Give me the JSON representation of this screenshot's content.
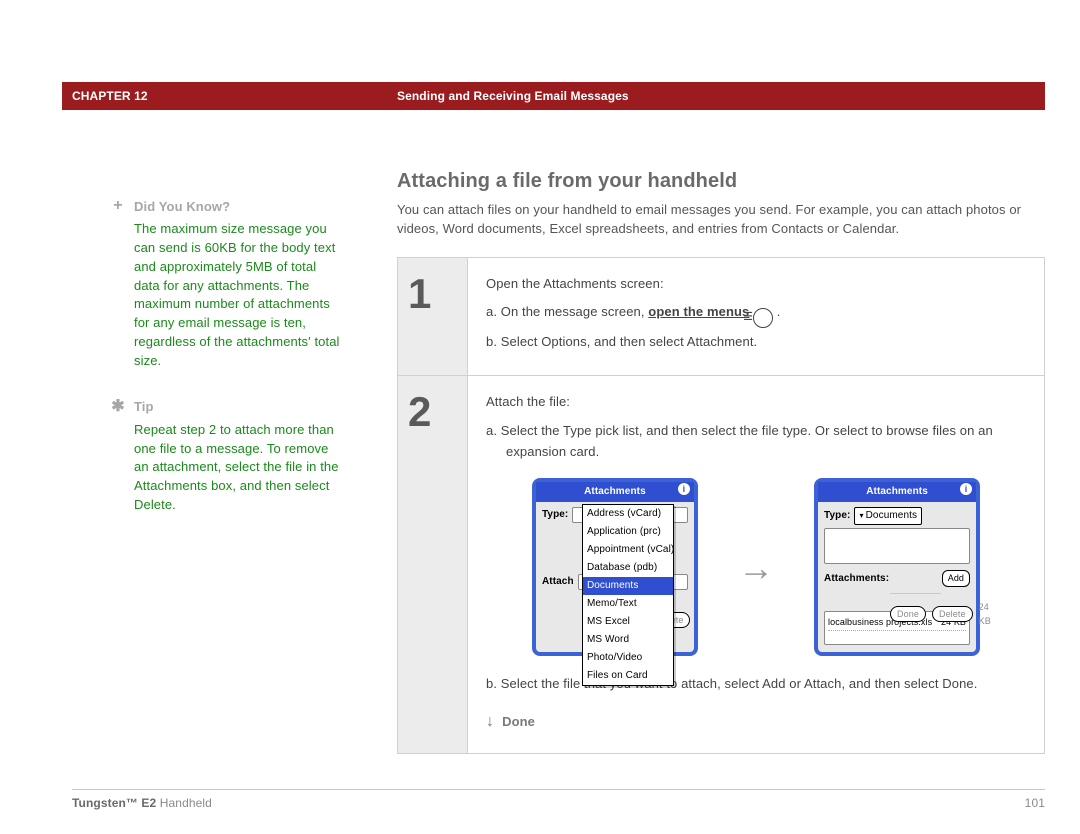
{
  "header": {
    "chapter_label": "CHAPTER 12",
    "chapter_title": "Sending and Receiving Email Messages"
  },
  "sidebar": {
    "dyk": {
      "heading": "Did You Know?",
      "body": "The maximum size message you can send is 60KB for the body text and approximately 5MB of total data for any attachments. The maximum number of attachments for any email message is ten, regardless of the attachments' total size."
    },
    "tip": {
      "heading": "Tip",
      "body": "Repeat step 2 to attach more than one file to a message. To remove an attachment, select the file in the Attachments box, and then select Delete."
    }
  },
  "page": {
    "title": "Attaching a file from your handheld",
    "intro": "You can attach files on your handheld to email messages you send. For example, you can attach photos or videos, Word documents, Excel spreadsheets, and entries from Contacts or Calendar."
  },
  "steps": {
    "s1": {
      "num": "1",
      "lead": "Open the Attachments screen:",
      "a_pre": "a.  On the message screen, ",
      "a_link": "open the menus",
      "a_post": " ",
      "b": "b.  Select Options, and then select Attachment."
    },
    "s2": {
      "num": "2",
      "lead": "Attach the file:",
      "a": "a.  Select the Type pick list, and then select the file type. Or select to browse files on an expansion card.",
      "b": "b.  Select the file that you want to attach, select Add or Attach, and then select Done.",
      "done": "Done"
    }
  },
  "palm": {
    "title": "Attachments",
    "type_label": "Type:",
    "attachments_label": "Attachments:",
    "menu_items": [
      "Address (vCard)",
      "Application (prc)",
      "Appointment (vCal)",
      "Database (pdb)",
      "Documents",
      "Memo/Text",
      "MS Excel",
      "MS Word",
      "Photo/Video",
      "Files on Card"
    ],
    "menu_selected_index": 4,
    "type_selected": "Documents",
    "attached_name": "localbusiness projects.xls",
    "attached_size": "24 KB",
    "total_size": "24 KB",
    "btn_done": "Done",
    "btn_delete": "Delete",
    "btn_add": "Add"
  },
  "footer": {
    "product_bold": "Tungsten™ E2",
    "product_rest": " Handheld",
    "page_no": "101"
  }
}
